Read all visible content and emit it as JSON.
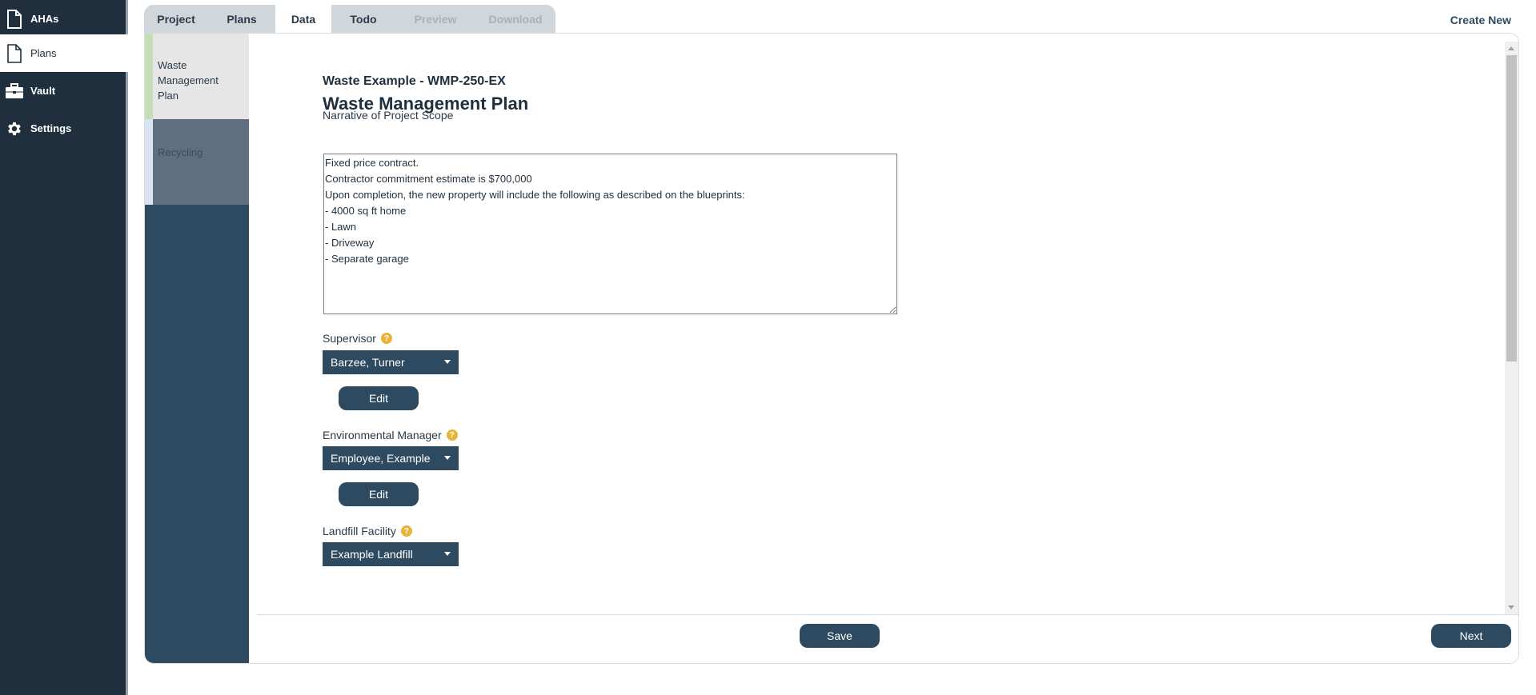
{
  "sidebar": {
    "items": [
      {
        "label": "AHAs",
        "icon": "document-icon",
        "active": false
      },
      {
        "label": "Plans",
        "icon": "document-icon",
        "active": true
      },
      {
        "label": "Vault",
        "icon": "toolbox-icon",
        "active": false
      },
      {
        "label": "Settings",
        "icon": "gear-icon",
        "active": false
      }
    ]
  },
  "tabs": [
    {
      "label": "Project",
      "state": "normal"
    },
    {
      "label": "Plans",
      "state": "normal"
    },
    {
      "label": "Data",
      "state": "active"
    },
    {
      "label": "Todo",
      "state": "normal"
    },
    {
      "label": "Preview",
      "state": "disabled"
    },
    {
      "label": "Download",
      "state": "disabled"
    }
  ],
  "header": {
    "create_new": "Create New"
  },
  "subnav": {
    "items": [
      {
        "label": "Waste Management Plan",
        "active": true
      },
      {
        "label": "Recycling",
        "active": false
      }
    ]
  },
  "form": {
    "subtitle": "Waste Example - WMP-250-EX",
    "title": "Waste Management Plan",
    "narrative": {
      "label": "Narrative of Project Scope",
      "value": "Fixed price contract.\nContractor commitment estimate is $700,000\nUpon completion, the new property will include the following as described on the blueprints:\n- 4000 sq ft home\n- Lawn\n- Driveway\n- Separate garage"
    },
    "supervisor": {
      "label": "Supervisor",
      "help": "?",
      "value": "Barzee, Turner",
      "edit_label": "Edit"
    },
    "environmental_manager": {
      "label": "Environmental Manager",
      "help": "?",
      "value": "Employee, Example",
      "edit_label": "Edit"
    },
    "landfill_facility": {
      "label": "Landfill Facility",
      "help": "?",
      "value": "Example Landfill"
    }
  },
  "footer": {
    "save_label": "Save",
    "next_label": "Next"
  },
  "colors": {
    "sidebar_bg": "#1f2f3d",
    "primary": "#2e4a60",
    "help_badge": "#e8b33a",
    "active_strip": "#c4deb5"
  }
}
